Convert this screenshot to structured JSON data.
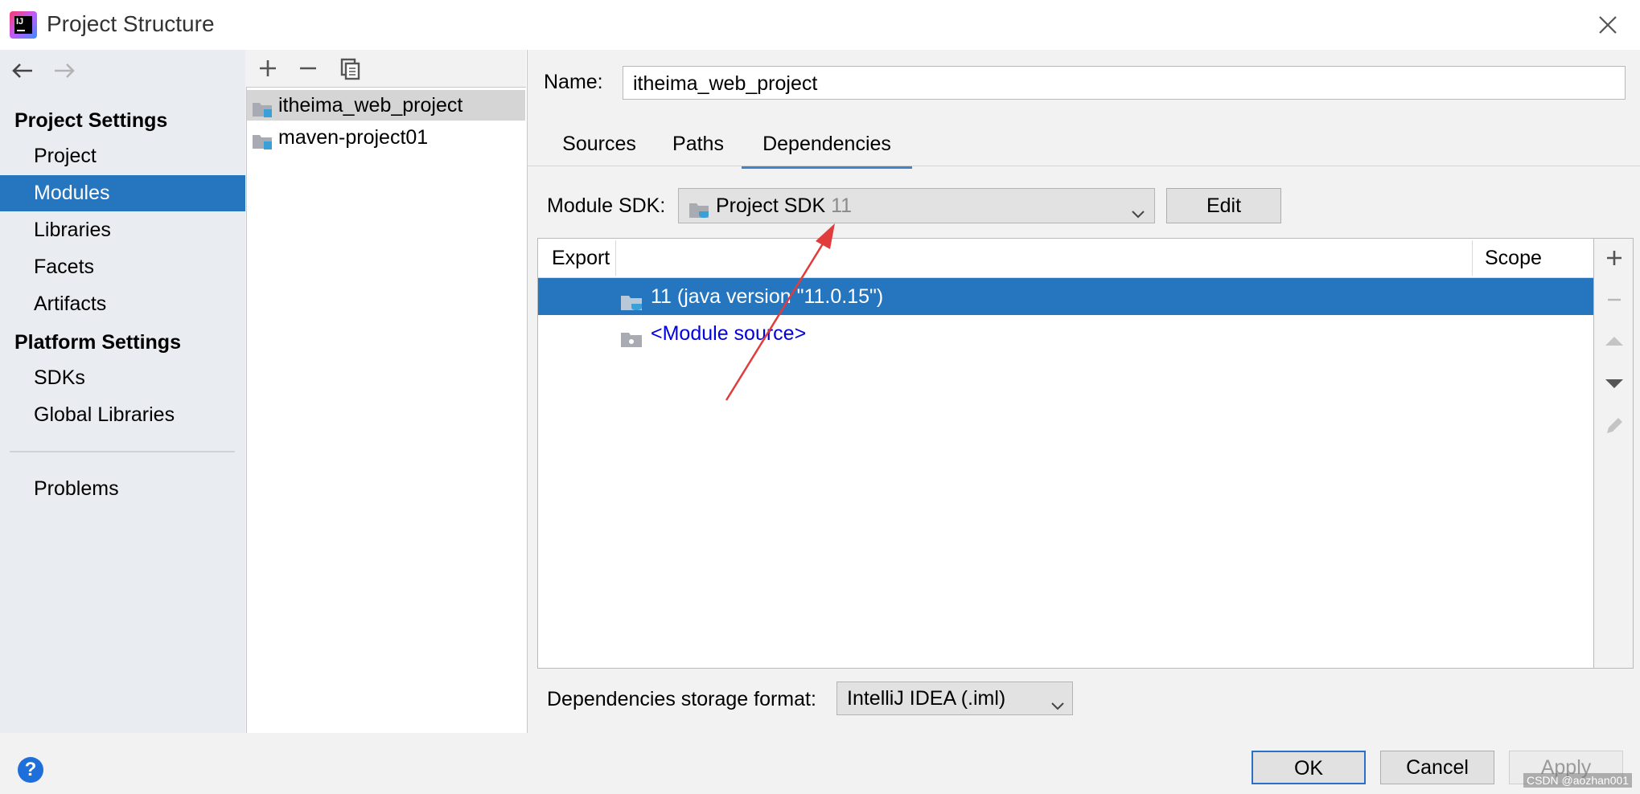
{
  "window": {
    "title": "Project Structure"
  },
  "sidebar": {
    "project_settings_label": "Project Settings",
    "project_items": [
      {
        "label": "Project",
        "selected": false
      },
      {
        "label": "Modules",
        "selected": true
      },
      {
        "label": "Libraries",
        "selected": false
      },
      {
        "label": "Facets",
        "selected": false
      },
      {
        "label": "Artifacts",
        "selected": false
      }
    ],
    "platform_settings_label": "Platform Settings",
    "platform_items": [
      {
        "label": "SDKs"
      },
      {
        "label": "Global Libraries"
      }
    ],
    "problems_label": "Problems"
  },
  "modules": {
    "items": [
      {
        "label": "itheima_web_project",
        "selected": true
      },
      {
        "label": "maven-project01",
        "selected": false
      }
    ]
  },
  "details": {
    "name_label": "Name:",
    "name_value": "itheima_web_project",
    "tabs": [
      {
        "label": "Sources",
        "active": false
      },
      {
        "label": "Paths",
        "active": false
      },
      {
        "label": "Dependencies",
        "active": true
      }
    ],
    "module_sdk_label": "Module SDK:",
    "module_sdk_value": "Project SDK",
    "module_sdk_version": "11",
    "edit_label": "Edit",
    "table": {
      "columns": [
        "Export",
        "Scope"
      ],
      "rows": [
        {
          "label": "11 (java version \"11.0.15\")",
          "selected": true
        },
        {
          "label": "<Module source>",
          "selected": false
        }
      ]
    },
    "storage_label": "Dependencies storage format:",
    "storage_value": "IntelliJ IDEA (.iml)"
  },
  "footer": {
    "help": "?",
    "ok_label": "OK",
    "cancel_label": "Cancel",
    "apply_label": "Apply",
    "watermark": "CSDN @aozhan001"
  },
  "colors": {
    "selection": "#2675bf",
    "arrow": "#e23b3b",
    "link": "#0000e0"
  }
}
